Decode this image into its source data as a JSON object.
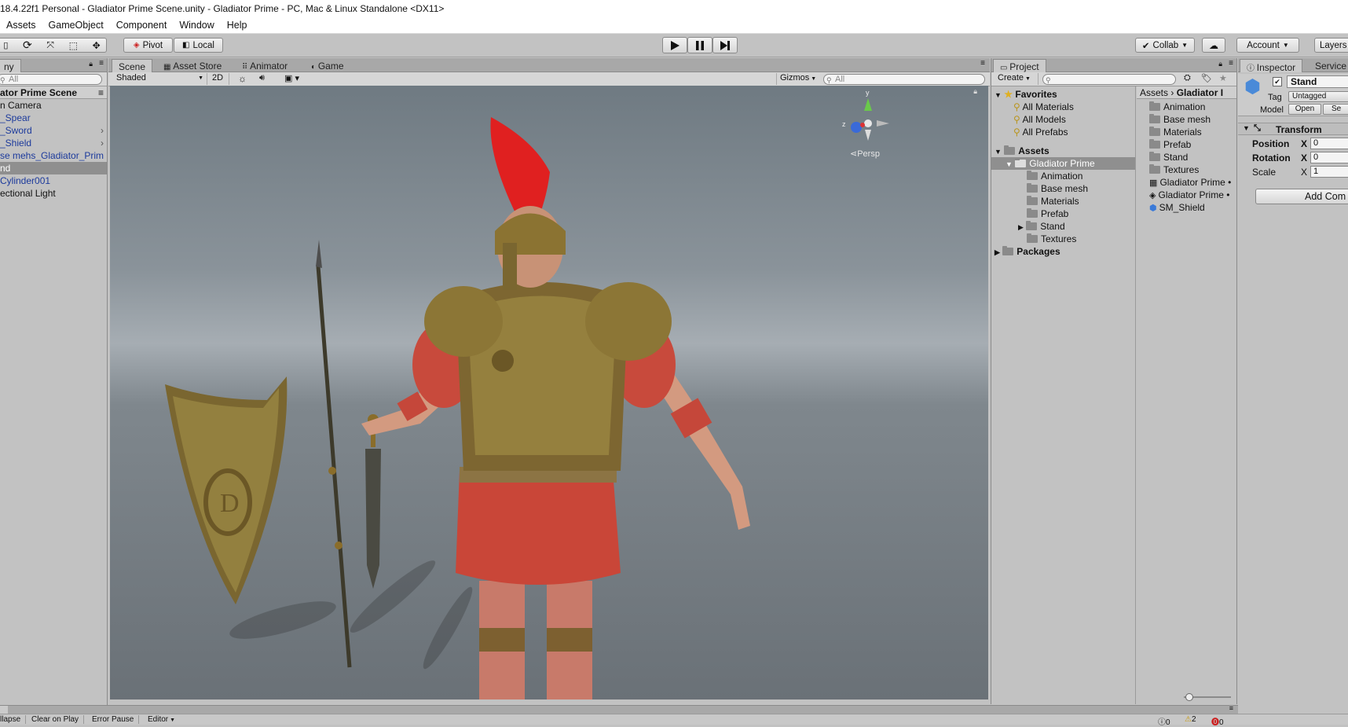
{
  "window_title": "18.4.22f1 Personal - Gladiator Prime Scene.unity - Gladiator Prime - PC, Mac & Linux Standalone <DX11>",
  "menu": [
    "Assets",
    "GameObject",
    "Component",
    "Window",
    "Help"
  ],
  "toolbar": {
    "pivot_label": "Pivot",
    "local_label": "Local",
    "collab_label": "Collab",
    "account_label": "Account",
    "layers_label": "Layers"
  },
  "hierarchy": {
    "tab_label": "ny",
    "search_placeholder": "All",
    "scene_name": "ator Prime Scene",
    "items": [
      {
        "label": "n Camera",
        "style": "normal"
      },
      {
        "label": "_Spear",
        "style": "blue"
      },
      {
        "label": "_Sword",
        "style": "blue"
      },
      {
        "label": "_Shield",
        "style": "blue"
      },
      {
        "label": "se mehs_Gladiator_Prim",
        "style": "blue"
      },
      {
        "label": "nd",
        "style": "selected"
      },
      {
        "label": "Cylinder001",
        "style": "blue"
      },
      {
        "label": "ectional Light",
        "style": "normal"
      }
    ]
  },
  "scene": {
    "tabs": [
      "Scene",
      "Asset Store",
      "Animator",
      "Game"
    ],
    "shading_mode": "Shaded",
    "mode_2d": "2D",
    "gizmos_label": "Gizmos",
    "search_placeholder": "All",
    "persp_label": "Persp",
    "gizmo_y": "y",
    "gizmo_z": "z"
  },
  "project": {
    "tab_label": "Project",
    "create_label": "Create",
    "favorites_label": "Favorites",
    "favorites": [
      "All Materials",
      "All Models",
      "All Prefabs"
    ],
    "assets_label": "Assets",
    "selected_folder": "Gladiator Prime",
    "subfolders": [
      "Animation",
      "Base mesh",
      "Materials",
      "Prefab",
      "Stand",
      "Textures"
    ],
    "packages_label": "Packages",
    "breadcrumb": [
      "Assets",
      "Gladiator I"
    ],
    "grid_items": [
      {
        "label": "Animation",
        "icon": "folder"
      },
      {
        "label": "Base mesh",
        "icon": "folder"
      },
      {
        "label": "Materials",
        "icon": "folder"
      },
      {
        "label": "Prefab",
        "icon": "folder"
      },
      {
        "label": "Stand",
        "icon": "folder"
      },
      {
        "label": "Textures",
        "icon": "folder"
      },
      {
        "label": "Gladiator Prime •",
        "icon": "scene"
      },
      {
        "label": "Gladiator Prime •",
        "icon": "unity"
      },
      {
        "label": "SM_Shield",
        "icon": "mesh"
      }
    ]
  },
  "inspector": {
    "tab_label": "Inspector",
    "services_label": "Service",
    "object_name": "Stand",
    "tag_label": "Tag",
    "tag_value": "Untagged",
    "model_label": "Model",
    "open_label": "Open",
    "select_label": "Se",
    "transform_label": "Transform",
    "position_label": "Position",
    "rotation_label": "Rotation",
    "scale_label": "Scale",
    "axis_x": "X",
    "position_x": "0",
    "rotation_x": "0",
    "scale_x": "1",
    "add_component_label": "Add Com"
  },
  "console": {
    "buttons": [
      "llapse",
      "Clear on Play",
      "Error Pause",
      "Editor"
    ],
    "counts": [
      "0",
      "2",
      "0"
    ]
  }
}
